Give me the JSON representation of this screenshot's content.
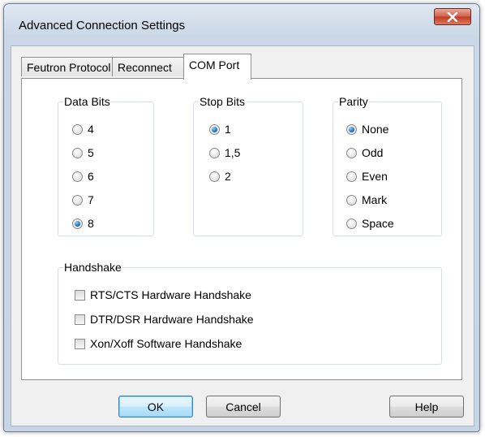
{
  "window": {
    "title": "Advanced Connection Settings",
    "close_icon": "close-x-icon"
  },
  "tabs": [
    {
      "label": "Feutron Protocol",
      "active": false
    },
    {
      "label": "Reconnect",
      "active": false
    },
    {
      "label": "COM Port",
      "active": true
    }
  ],
  "data_bits": {
    "legend": "Data Bits",
    "options": [
      "4",
      "5",
      "6",
      "7",
      "8"
    ],
    "selected": "8"
  },
  "stop_bits": {
    "legend": "Stop Bits",
    "options": [
      "1",
      "1,5",
      "2"
    ],
    "selected": "1"
  },
  "parity": {
    "legend": "Parity",
    "options": [
      "None",
      "Odd",
      "Even",
      "Mark",
      "Space"
    ],
    "selected": "None"
  },
  "handshake": {
    "legend": "Handshake",
    "options": [
      {
        "label": "RTS/CTS Hardware Handshake",
        "checked": false
      },
      {
        "label": "DTR/DSR Hardware Handshake",
        "checked": false
      },
      {
        "label": "Xon/Xoff Software Handshake",
        "checked": false
      }
    ]
  },
  "buttons": {
    "ok": "OK",
    "cancel": "Cancel",
    "help": "Help"
  },
  "colors": {
    "accent_radio": "#1e73b8",
    "close_button": "#c23b22",
    "default_button": "#bee6fd"
  }
}
